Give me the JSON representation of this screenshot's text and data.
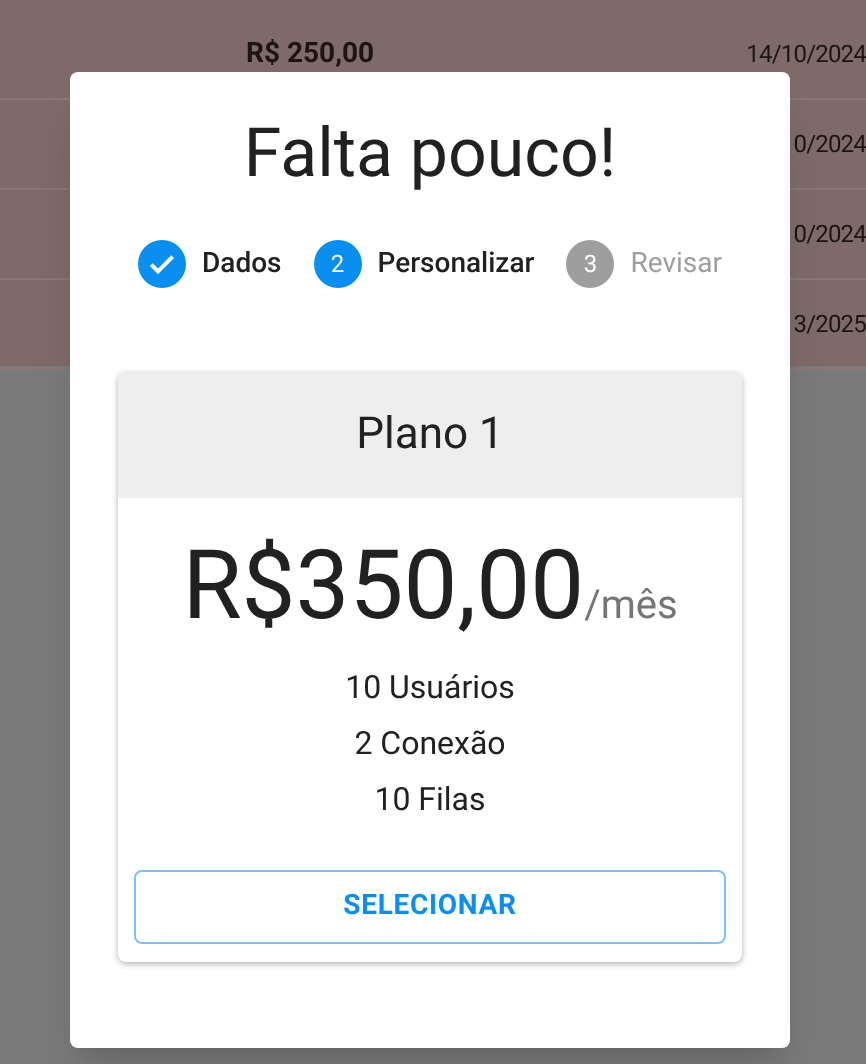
{
  "background_rows": [
    {
      "amount": "R$ 250,00",
      "date": "14/10/2024"
    },
    {
      "date": "0/2024"
    },
    {
      "date": "0/2024"
    },
    {
      "date": "3/2025"
    }
  ],
  "dialog": {
    "title": "Falta pouco!",
    "steps": [
      {
        "label": "Dados",
        "kind": "completed"
      },
      {
        "label": "Personalizar",
        "number": "2",
        "kind": "active"
      },
      {
        "label": "Revisar",
        "number": "3",
        "kind": "pending"
      }
    ],
    "plan": {
      "name": "Plano 1",
      "price": "R$350,00",
      "period": "/mês",
      "features": [
        "10 Usuários",
        "2 Conexão",
        "10 Filas"
      ],
      "button": "SELECIONAR"
    }
  }
}
